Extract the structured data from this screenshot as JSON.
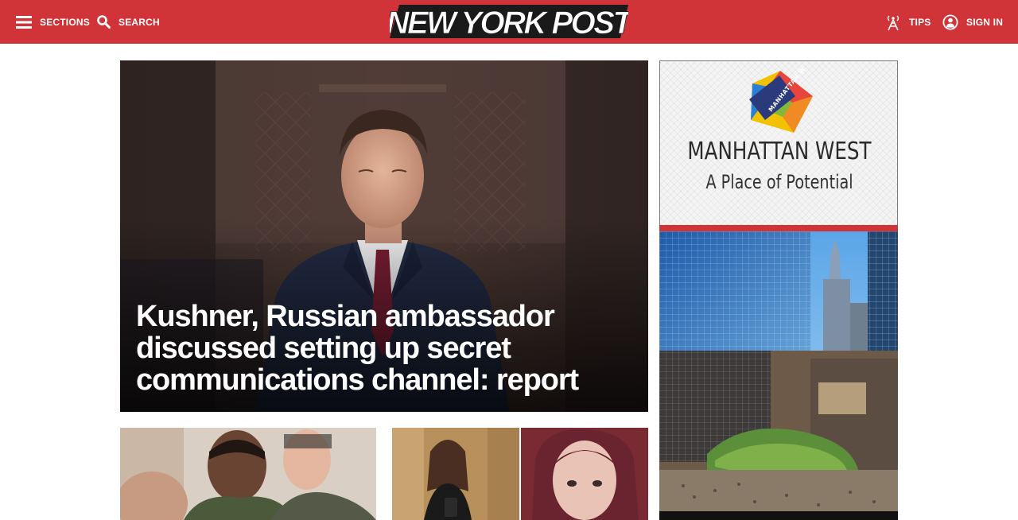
{
  "header": {
    "sections_label": "SECTIONS",
    "search_label": "SEARCH",
    "logo_text": "NEW YORK POST",
    "tips_label": "TIPS",
    "signin_label": "SIGN IN"
  },
  "main_story": {
    "headline": "Kushner, Russian ambassador discussed setting up secret communications channel: report"
  },
  "ad": {
    "title": "MANHATTAN WEST",
    "tagline": "A Place of Potential",
    "logo_text": "MANHATTAN WEST"
  },
  "colors": {
    "brand_red": "#d13438",
    "text_white": "#ffffff"
  },
  "icons": [
    "menu-icon",
    "search-icon",
    "tips-antenna-icon",
    "user-icon"
  ]
}
